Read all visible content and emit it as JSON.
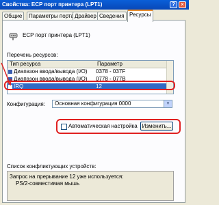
{
  "window": {
    "title": "Свойства: ECP порт принтера (LPT1)",
    "help_btn": "?",
    "close_btn": "×"
  },
  "tabs": [
    "Общие",
    "Параметры порта",
    "Драйвер",
    "Сведения",
    "Ресурсы"
  ],
  "device": {
    "name": "ECP порт принтера (LPT1)"
  },
  "resources": {
    "label": "Перечень ресурсов:",
    "headers": [
      "Тип ресурса",
      "Параметр"
    ],
    "rows": [
      {
        "type": "Диапазон ввода/вывода (I/O)",
        "value": "0378 - 037F"
      },
      {
        "type": "Диапазон ввода/вывода (I/O)",
        "value": "0778 - 077B"
      },
      {
        "type": "IRQ",
        "value": "12"
      }
    ],
    "selected_index": 2
  },
  "config": {
    "label": "Конфигурация:",
    "value": "Основная конфигурация 0000"
  },
  "auto_config": {
    "label": "Автоматическая настройка",
    "checked": false
  },
  "change_button": "Изменить...",
  "conflicts": {
    "label": "Список конфликтующих устройств:",
    "lines": [
      "Запрос на прерывание 12 уже используется:",
      "PS/2-совместимая мышь"
    ]
  }
}
